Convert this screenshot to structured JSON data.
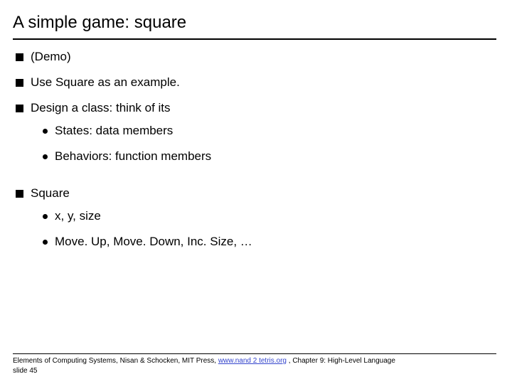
{
  "title": "A simple game: square",
  "bullets": {
    "b1": "(Demo)",
    "b2": "Use Square as an example.",
    "b3": "Design a class: think of its",
    "b3a": "States: data members",
    "b3b": "Behaviors: function members",
    "b4": "Square",
    "b4a": "x, y, size",
    "b4b": "Move. Up, Move. Down, Inc. Size, …"
  },
  "footer": {
    "pre": "Elements of Computing Systems, Nisan & Schocken, MIT Press, ",
    "link": "www.nand 2 tetris.org",
    "post": " , Chapter 9: High-Level Language",
    "slide": "slide 45"
  }
}
